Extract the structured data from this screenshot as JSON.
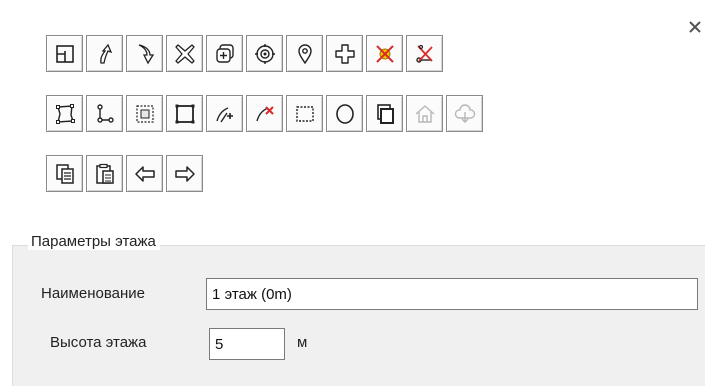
{
  "toolbar": {
    "rows": [
      [
        "floor-plan",
        "arrow-curve-up",
        "arrow-curve-down",
        "delete-shape",
        "add-layers",
        "target",
        "location-pin",
        "add-cross",
        "remove-point-red",
        "remove-scissors-red"
      ],
      [
        "polygon-edit",
        "polyline",
        "select-region",
        "rectangle",
        "add-node",
        "delete-node",
        "dashed-rect",
        "ellipse",
        "copy-shape",
        "home",
        "cloud-download"
      ],
      [
        "copy",
        "paste",
        "arrow-left",
        "arrow-right"
      ]
    ],
    "disabled": [
      "home",
      "cloud-download"
    ]
  },
  "floor_params": {
    "group_title": "Параметры этажа",
    "name_label": "Наименование",
    "name_value": "1 этаж (0m)",
    "height_label": "Высота этажа",
    "height_value": "5",
    "height_unit": "м"
  },
  "colors": {
    "panel": "#f0f0f0",
    "button_border": "#8a8a8a",
    "red_accent": "#d92a2a",
    "yellow_accent": "#f2c500"
  }
}
